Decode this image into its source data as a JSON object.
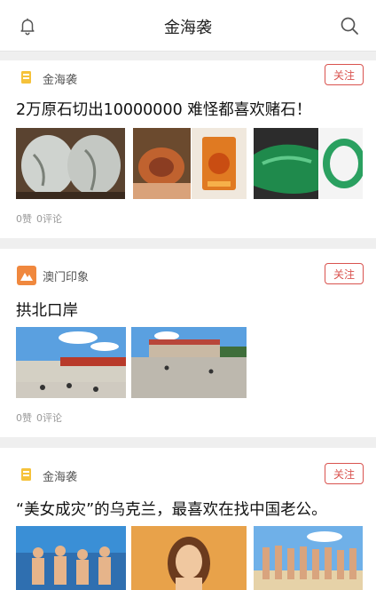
{
  "header": {
    "title": "金海袭"
  },
  "articles": [
    {
      "source": "金海袭",
      "follow": "关注",
      "title": "2万原石切出10000000 难怪都喜欢赌石！",
      "likes": "0赞",
      "comments": "0评论"
    },
    {
      "source": "澳门印象",
      "follow": "关注",
      "title": "拱北口岸",
      "likes": "0赞",
      "comments": "0评论"
    },
    {
      "source": "金海袭",
      "follow": "关注",
      "title": "“美女成灾”的乌克兰，最喜欢在找中国老公。"
    }
  ]
}
